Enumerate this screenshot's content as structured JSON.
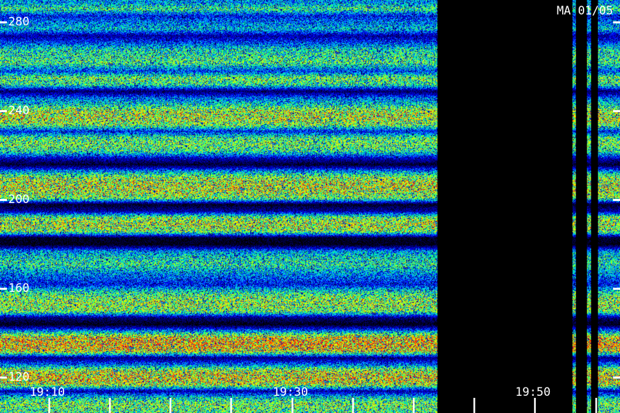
{
  "chart_data": {
    "type": "heatmap",
    "title": "MA 01/05",
    "xlabel": "",
    "ylabel": "",
    "xlim": [
      "19:06",
      "19:57"
    ],
    "ylim": [
      104,
      290
    ],
    "y_ticks": [
      {
        "value": 280,
        "label": "280"
      },
      {
        "value": 240,
        "label": "240"
      },
      {
        "value": 200,
        "label": "200"
      },
      {
        "value": 160,
        "label": "160"
      },
      {
        "value": 120,
        "label": "120"
      }
    ],
    "x_tick_labels": [
      {
        "time": "19:10",
        "label": "19:10"
      },
      {
        "time": "19:30",
        "label": "19:30"
      },
      {
        "time": "19:50",
        "label": "19:50"
      }
    ],
    "x_minor_tick_interval_minutes": 5,
    "colormap": [
      "#000000",
      "#00008c",
      "#0000ff",
      "#00c8ff",
      "#00ff80",
      "#d0ff00",
      "#ffee00",
      "#ff2a00"
    ],
    "data_segments": [
      {
        "start": "19:06",
        "end": "19:42"
      },
      {
        "start": "19:53.1",
        "end": "19:53.4"
      },
      {
        "start": "19:54.3",
        "end": "19:54.6"
      },
      {
        "start": "19:55.2",
        "end": "19:57"
      }
    ],
    "intensity_profile": [
      {
        "y": 289,
        "level": 0.45
      },
      {
        "y": 286,
        "level": 0.62
      },
      {
        "y": 283,
        "level": 0.3
      },
      {
        "y": 280,
        "level": 0.42
      },
      {
        "y": 277,
        "level": 0.5
      },
      {
        "y": 274,
        "level": 0.2
      },
      {
        "y": 271,
        "level": 0.35
      },
      {
        "y": 268,
        "level": 0.55
      },
      {
        "y": 265,
        "level": 0.6
      },
      {
        "y": 262,
        "level": 0.65
      },
      {
        "y": 258,
        "level": 0.35
      },
      {
        "y": 255,
        "level": 0.7
      },
      {
        "y": 252,
        "level": 0.6
      },
      {
        "y": 249,
        "level": 0.12
      },
      {
        "y": 246,
        "level": 0.4
      },
      {
        "y": 243,
        "level": 0.55
      },
      {
        "y": 240,
        "level": 0.78
      },
      {
        "y": 237,
        "level": 0.8
      },
      {
        "y": 234,
        "level": 0.72
      },
      {
        "y": 231,
        "level": 0.3
      },
      {
        "y": 228,
        "level": 0.65
      },
      {
        "y": 225,
        "level": 0.7
      },
      {
        "y": 222,
        "level": 0.6
      },
      {
        "y": 219,
        "level": 0.25
      },
      {
        "y": 216,
        "level": 0.05
      },
      {
        "y": 213,
        "level": 0.45
      },
      {
        "y": 210,
        "level": 0.75
      },
      {
        "y": 207,
        "level": 0.82
      },
      {
        "y": 204,
        "level": 0.8
      },
      {
        "y": 201,
        "level": 0.7
      },
      {
        "y": 198,
        "level": 0.04
      },
      {
        "y": 195,
        "level": 0.2
      },
      {
        "y": 192,
        "level": 0.72
      },
      {
        "y": 189,
        "level": 0.8
      },
      {
        "y": 186,
        "level": 0.72
      },
      {
        "y": 183,
        "level": 0.05
      },
      {
        "y": 180,
        "level": 0.02
      },
      {
        "y": 177,
        "level": 0.45
      },
      {
        "y": 174,
        "level": 0.55
      },
      {
        "y": 171,
        "level": 0.6
      },
      {
        "y": 168,
        "level": 0.48
      },
      {
        "y": 165,
        "level": 0.38
      },
      {
        "y": 162,
        "level": 0.3
      },
      {
        "y": 159,
        "level": 0.55
      },
      {
        "y": 156,
        "level": 0.72
      },
      {
        "y": 153,
        "level": 0.75
      },
      {
        "y": 150,
        "level": 0.7
      },
      {
        "y": 147,
        "level": 0.15
      },
      {
        "y": 144,
        "level": 0.02
      },
      {
        "y": 141,
        "level": 0.45
      },
      {
        "y": 138,
        "level": 0.9
      },
      {
        "y": 135,
        "level": 0.95
      },
      {
        "y": 132,
        "level": 0.85
      },
      {
        "y": 129,
        "level": 0.15
      },
      {
        "y": 126,
        "level": 0.4
      },
      {
        "y": 123,
        "level": 0.8
      },
      {
        "y": 120,
        "level": 0.88
      },
      {
        "y": 117,
        "level": 0.8
      },
      {
        "y": 114,
        "level": 0.2
      },
      {
        "y": 111,
        "level": 0.55
      },
      {
        "y": 108,
        "level": 0.72
      },
      {
        "y": 105,
        "level": 0.65
      }
    ]
  }
}
